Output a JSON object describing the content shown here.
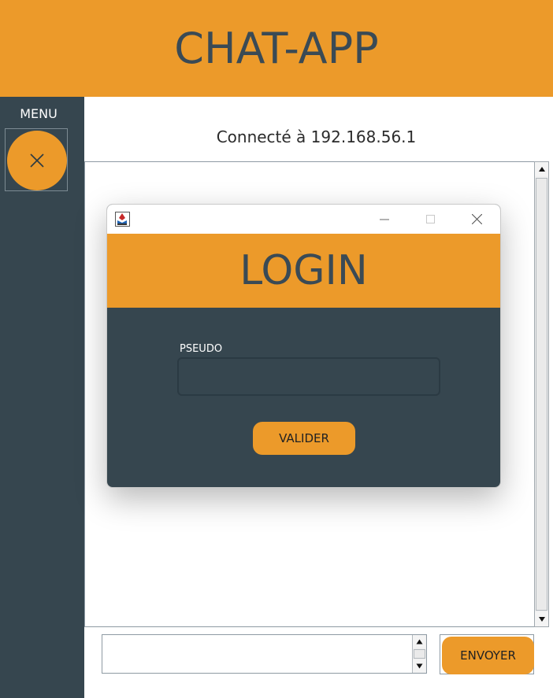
{
  "header": {
    "title": "CHAT-APP"
  },
  "sidebar": {
    "menu_label": "MENU",
    "close_icon": "close-icon"
  },
  "status": {
    "text": "Connecté à 192.168.56.1"
  },
  "login_dialog": {
    "app_icon": "java-app-icon",
    "title": "LOGIN",
    "pseudo_label": "PSEUDO",
    "pseudo_value": "",
    "submit_label": "VALIDER",
    "window_controls": [
      "minimize-icon",
      "maximize-icon",
      "close-icon"
    ]
  },
  "composer": {
    "message_value": "",
    "send_label": "ENVOYER"
  },
  "colors": {
    "accent": "#ec9a2a",
    "dark": "#36464f",
    "title_text": "#3a4a55"
  }
}
